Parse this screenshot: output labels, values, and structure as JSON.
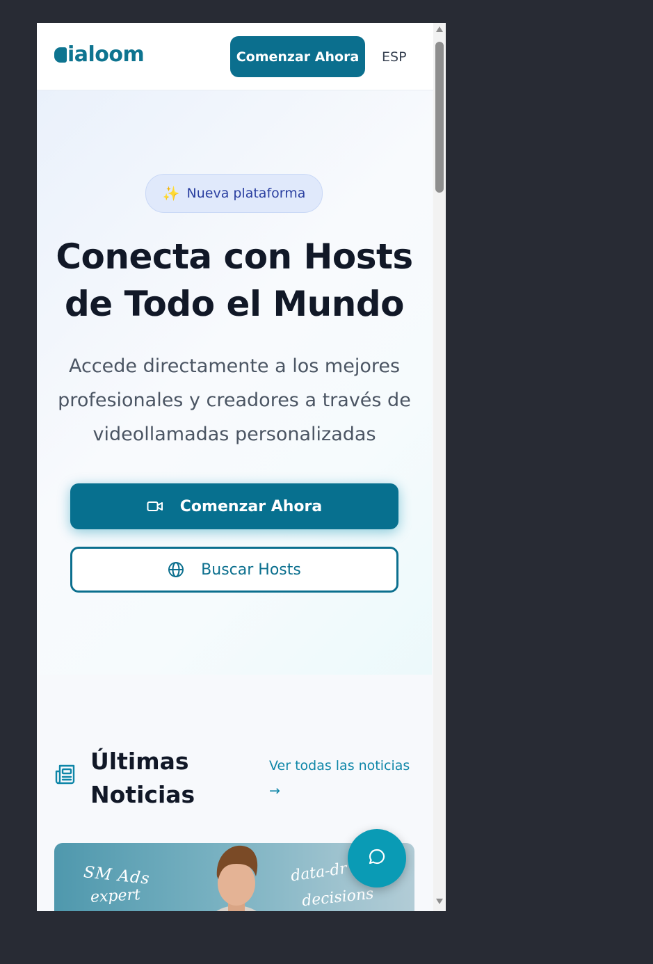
{
  "header": {
    "logo_text": "ialoom",
    "cta_label": "Comenzar Ahora",
    "language": "ESP"
  },
  "hero": {
    "badge_label": "Nueva plataforma",
    "badge_icon": "sparkles-icon",
    "title_line1": "Conecta con Hosts",
    "title_line2": "de Todo el Mundo",
    "subtitle": "Accede directamente a los mejores profesionales y creadores a través de videollamadas personalizadas",
    "primary_cta": "Comenzar Ahora",
    "secondary_cta": "Buscar Hosts"
  },
  "news": {
    "title_line1": "Últimas",
    "title_line2": "Noticias",
    "link_line1": "Ver todas las noticias",
    "link_line2": "→",
    "card": {
      "text1": "SM Ads",
      "text2": "expert",
      "text3": "data-dr",
      "text4": "decisions"
    }
  },
  "colors": {
    "brand": "#0b6f8e",
    "brand_light": "#0e86a8",
    "background": "#282b34"
  }
}
